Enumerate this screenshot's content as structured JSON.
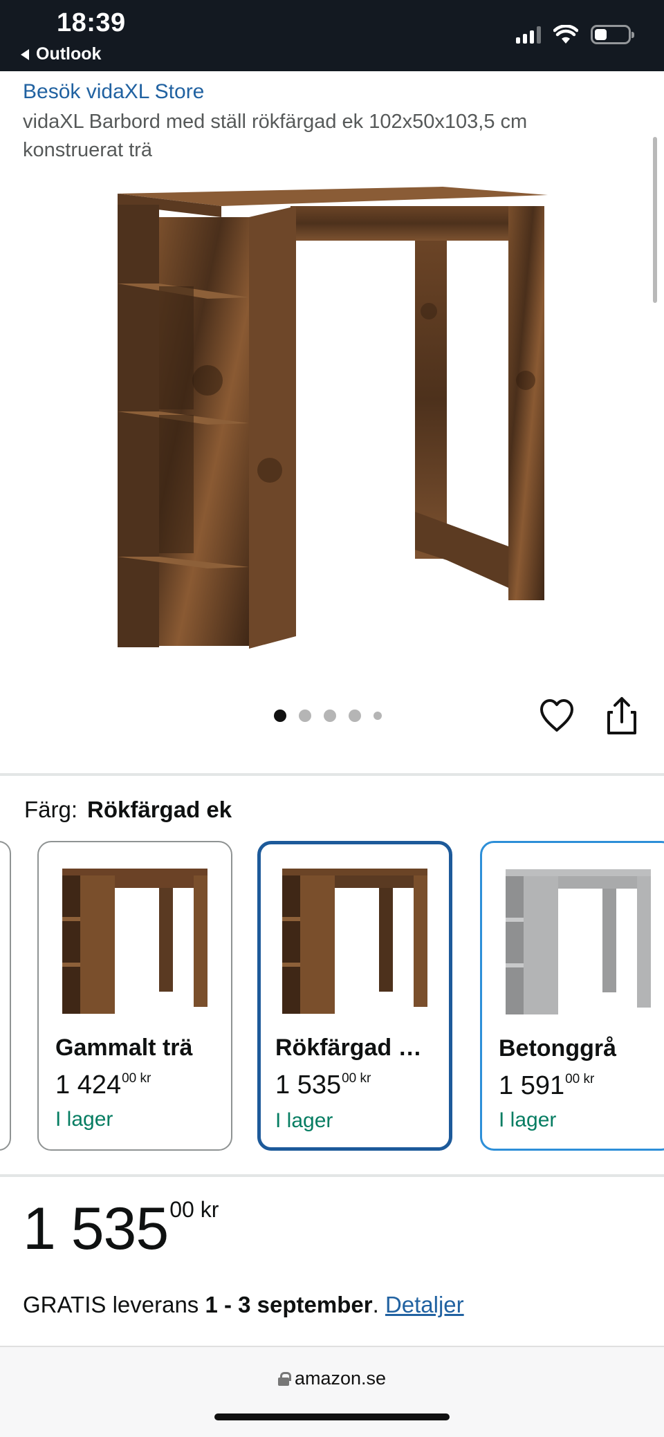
{
  "status_bar": {
    "time": "18:39",
    "back_label": "Outlook"
  },
  "product": {
    "store_link": "Besök vidaXL Store",
    "title": "vidaXL Barbord med ställ rökfärgad ek 102x50x103,5 cm konstruerat trä"
  },
  "carousel": {
    "image_count": 5,
    "active_index": 0
  },
  "color": {
    "label": "Färg:",
    "selected": "Rökfärgad ek"
  },
  "variants": [
    {
      "name": "Gammalt trä",
      "price_main": "1 424",
      "price_cents": "00",
      "currency": "kr",
      "stock": "I lager",
      "wood": "#6b4226"
    },
    {
      "name": "Rökfärgad …",
      "price_main": "1 535",
      "price_cents": "00",
      "currency": "kr",
      "stock": "I lager",
      "wood": "#5a3a22"
    },
    {
      "name": "Betonggrå",
      "price_main": "1 591",
      "price_cents": "00",
      "currency": "kr",
      "stock": "I lager",
      "wood": "#a9aaab"
    }
  ],
  "price": {
    "main": "1 535",
    "cents": "00",
    "currency": "kr"
  },
  "delivery": {
    "prefix": "GRATIS leverans",
    "dates": "1 - 3 september",
    "suffix": ".",
    "details_link": "Detaljer"
  },
  "browser": {
    "url": "amazon.se"
  },
  "colors": {
    "link": "#2162a1",
    "in_stock": "#067d62",
    "selected_border": "#1d5a9a",
    "status_bar_bg": "#131921"
  }
}
